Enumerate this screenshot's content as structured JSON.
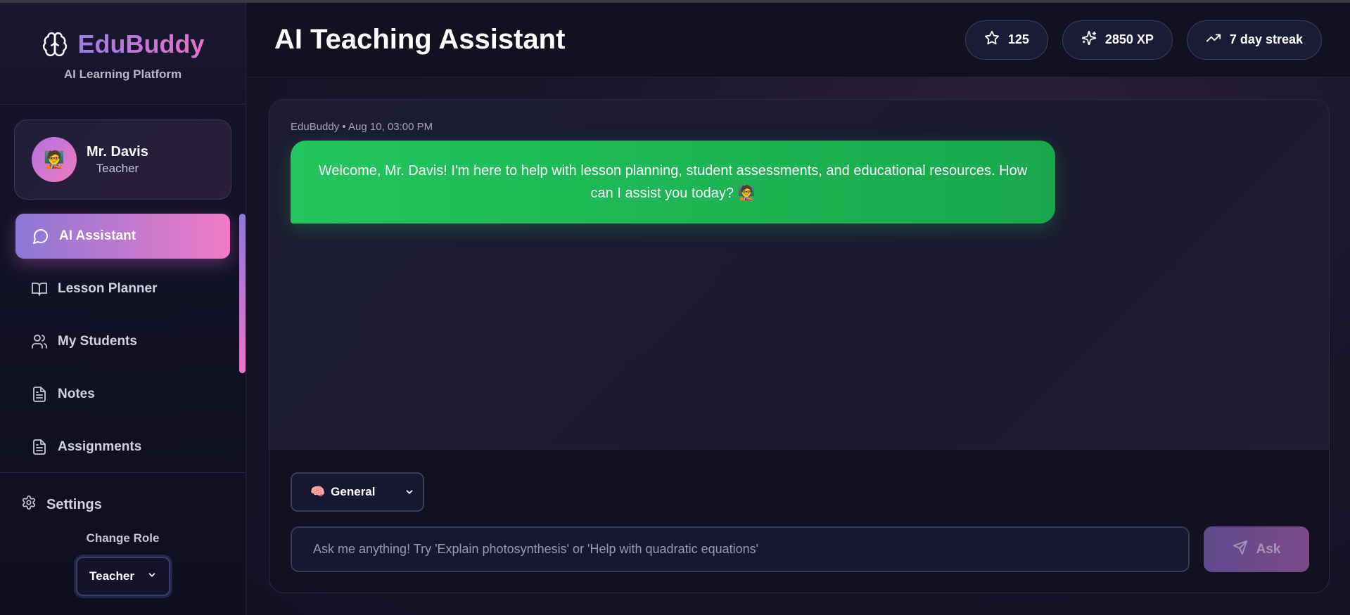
{
  "brand": {
    "name": "EduBuddy",
    "subtitle": "AI Learning Platform",
    "icon": "brain-icon"
  },
  "profile": {
    "name": "Mr. Davis",
    "role": "Teacher",
    "avatar": "🧑‍🏫"
  },
  "nav": {
    "items": [
      {
        "label": "AI Assistant",
        "icon": "chat-bubble-icon",
        "active": true
      },
      {
        "label": "Lesson Planner",
        "icon": "book-open-icon",
        "active": false
      },
      {
        "label": "My Students",
        "icon": "users-icon",
        "active": false
      },
      {
        "label": "Notes",
        "icon": "document-icon",
        "active": false
      },
      {
        "label": "Assignments",
        "icon": "document-icon",
        "active": false
      }
    ]
  },
  "settings": {
    "label": "Settings",
    "icon": "gear-icon"
  },
  "role_switch": {
    "label": "Change Role",
    "selected": "Teacher"
  },
  "header": {
    "title": "AI Teaching Assistant",
    "stats": {
      "stars": "125",
      "xp": "2850 XP",
      "streak": "7 day streak"
    }
  },
  "chat": {
    "messages": [
      {
        "sender": "EduBuddy",
        "time": "Aug 10, 03:00 PM",
        "text": "Welcome, Mr. Davis! I'm here to help with lesson planning, student assessments, and educational resources. How can I assist you today? 🧑‍🏫"
      }
    ]
  },
  "composer": {
    "mode": {
      "emoji": "🧠",
      "label": "General"
    },
    "placeholder": "Ask me anything! Try 'Explain photosynthesis' or 'Help with quadratic equations'",
    "send_label": "Ask"
  },
  "colors": {
    "accent_gradient_start": "#8b78d6",
    "accent_gradient_end": "#f27ac6",
    "message_bubble": "#22c55e",
    "background": "#0e0e1c"
  }
}
